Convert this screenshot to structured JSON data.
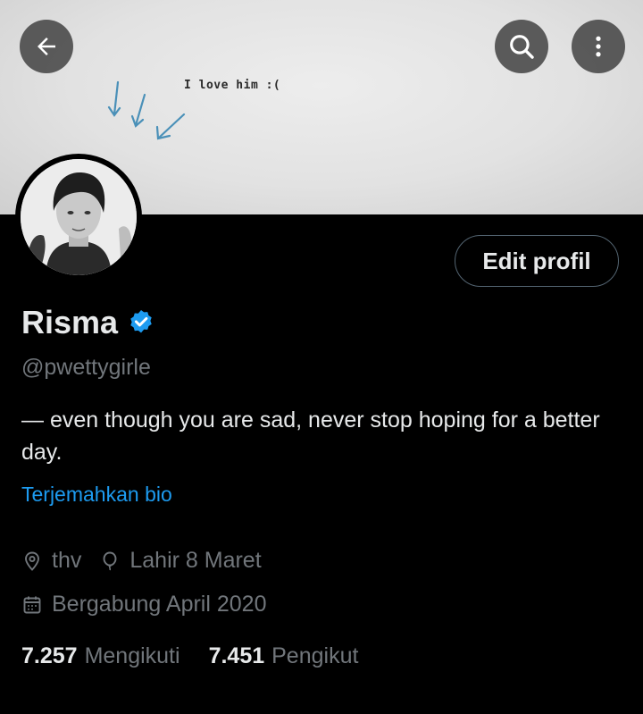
{
  "banner": {
    "text": "I love him :("
  },
  "header": {
    "back_icon": "arrow-left-icon",
    "search_icon": "search-icon",
    "more_icon": "more-vertical-icon"
  },
  "profile": {
    "name": "Risma",
    "handle": "@pwettygirle",
    "bio": "— even though you are sad, never stop hoping for a better day.",
    "translate_bio": "Terjemahkan bio",
    "location": "thv",
    "birthday": "Lahir 8 Maret",
    "joined": "Bergabung April 2020",
    "edit_button": "Edit profil",
    "verified_color": "#1d9bf0"
  },
  "stats": {
    "following_count": "7.257",
    "following_label": "Mengikuti",
    "followers_count": "7.451",
    "followers_label": "Pengikut"
  },
  "colors": {
    "background": "#000000",
    "primary_text": "#e7e9ea",
    "secondary_text": "#71767b",
    "accent": "#1d9bf0"
  }
}
